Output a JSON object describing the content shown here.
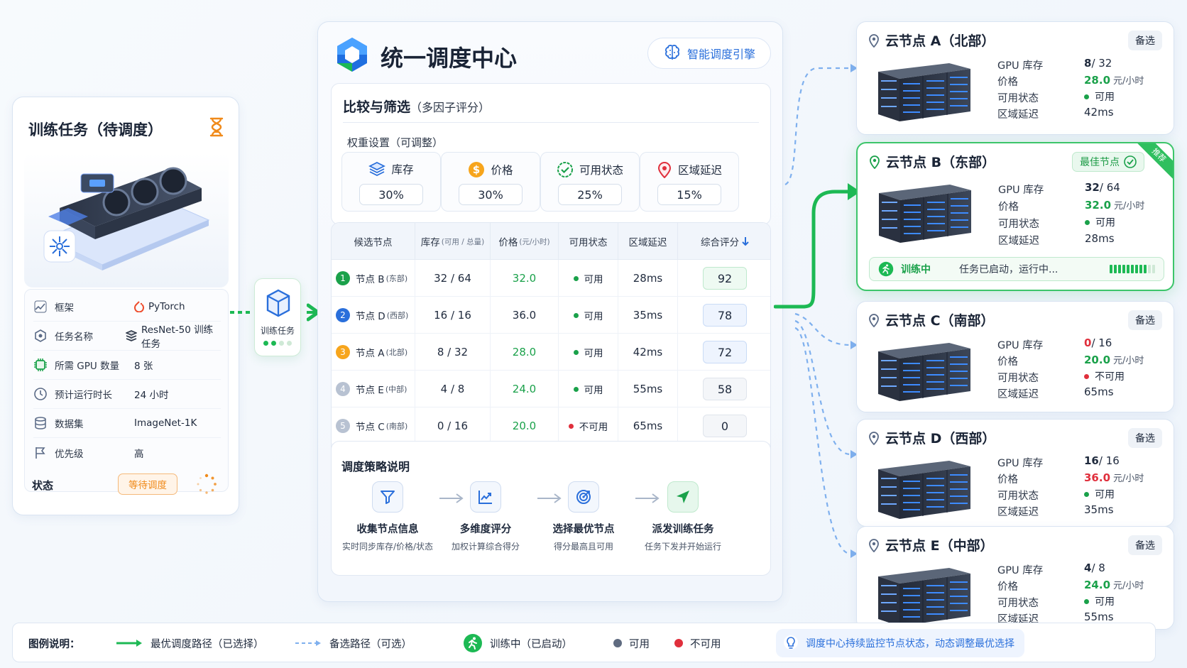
{
  "task": {
    "title": "训练任务（待调度）",
    "props": [
      {
        "icon": "framework-icon",
        "label": "框架",
        "value": "PyTorch",
        "value_icon": "pytorch-icon"
      },
      {
        "icon": "task-name-icon",
        "label": "任务名称",
        "value": "ResNet-50 训练任务",
        "value_icon": "layers-icon"
      },
      {
        "icon": "gpu-chip-icon",
        "label": "所需 GPU 数量",
        "value": "8 张"
      },
      {
        "icon": "clock-icon",
        "label": "预计运行时长",
        "value": "24 小时"
      },
      {
        "icon": "database-icon",
        "label": "数据集",
        "value": "ImageNet-1K"
      },
      {
        "icon": "flag-icon",
        "label": "优先级",
        "value": "高"
      }
    ],
    "status_label": "状态",
    "status_value": "等待调度"
  },
  "connector": {
    "label": "训练任务"
  },
  "center": {
    "title": "统一调度中心",
    "engine": "智能调度引擎",
    "compare_title": "比较与筛选",
    "compare_sub": "（多因子评分）",
    "weights_title": "权重设置（可调整）",
    "weights": [
      {
        "icon": "stack-icon",
        "label": "库存",
        "value": "30%"
      },
      {
        "icon": "dollar-icon",
        "label": "价格",
        "value": "30%"
      },
      {
        "icon": "check-badge-icon",
        "label": "可用状态",
        "value": "25%"
      },
      {
        "icon": "location-icon",
        "label": "区域延迟",
        "value": "15%"
      }
    ],
    "table": {
      "headers": [
        {
          "main": "候选节点",
          "sub": ""
        },
        {
          "main": "库存",
          "sub": "(可用 / 总量)"
        },
        {
          "main": "价格",
          "sub": "(元/小时)"
        },
        {
          "main": "可用状态",
          "sub": ""
        },
        {
          "main": "区域延迟",
          "sub": ""
        },
        {
          "main": "综合评分",
          "sub": ""
        }
      ],
      "rows": [
        {
          "rank": "1",
          "node": "节点 B",
          "region": "(东部)",
          "stock": "32 / 64",
          "price": "32.0",
          "status": "可用",
          "latency": "28ms",
          "score": "92"
        },
        {
          "rank": "2",
          "node": "节点 D",
          "region": "(西部)",
          "stock": "16 / 16",
          "price": "36.0",
          "status": "可用",
          "latency": "35ms",
          "score": "78"
        },
        {
          "rank": "3",
          "node": "节点 A",
          "region": "(北部)",
          "stock": "8 / 32",
          "price": "28.0",
          "status": "可用",
          "latency": "42ms",
          "score": "72"
        },
        {
          "rank": "4",
          "node": "节点 E",
          "region": "(中部)",
          "stock": "4 / 8",
          "price": "24.0",
          "status": "可用",
          "latency": "55ms",
          "score": "58"
        },
        {
          "rank": "5",
          "node": "节点 C",
          "region": "(南部)",
          "stock": "0 / 16",
          "price": "20.0",
          "status": "不可用",
          "latency": "65ms",
          "score": "0"
        }
      ]
    },
    "strategy_title": "调度策略说明",
    "steps": [
      {
        "icon": "funnel-icon",
        "title": "收集节点信息",
        "desc": "实时同步库存/价格/状态"
      },
      {
        "icon": "trend-chart-icon",
        "title": "多维度评分",
        "desc": "加权计算综合得分"
      },
      {
        "icon": "target-icon",
        "title": "选择最优节点",
        "desc": "得分最高且可用"
      },
      {
        "icon": "send-icon",
        "title": "派发训练任务",
        "desc": "任务下发并开始运行"
      }
    ]
  },
  "nodes": [
    {
      "title": "云节点 A（北部）",
      "badge": "备选",
      "gpu_label": "GPU 库存",
      "gpu_a": "8",
      "gpu_b": " / 32",
      "price_label": "价格",
      "price": "28.0",
      "unit": "元/小时",
      "status_label": "可用状态",
      "status": "可用",
      "lat_label": "区域延迟",
      "latency": "42ms"
    },
    {
      "title": "云节点 B（东部）",
      "badge": "最佳节点",
      "ribbon": "推荐",
      "gpu_label": "GPU 库存",
      "gpu_a": "32",
      "gpu_b": " / 64",
      "price_label": "价格",
      "price": "32.0",
      "unit": "元/小时",
      "status_label": "可用状态",
      "status": "可用",
      "lat_label": "区域延迟",
      "latency": "28ms",
      "train_label": "训练中",
      "train_text": "任务已启动，运行中..."
    },
    {
      "title": "云节点 C（南部）",
      "badge": "备选",
      "gpu_label": "GPU 库存",
      "gpu_a": "0",
      "gpu_b": " / 16",
      "price_label": "价格",
      "price": "20.0",
      "unit": "元/小时",
      "status_label": "可用状态",
      "status": "不可用",
      "lat_label": "区域延迟",
      "latency": "65ms"
    },
    {
      "title": "云节点 D（西部）",
      "badge": "备选",
      "gpu_label": "GPU 库存",
      "gpu_a": "16",
      "gpu_b": " / 16",
      "price_label": "价格",
      "price": "36.0",
      "unit": "元/小时",
      "status_label": "可用状态",
      "status": "可用",
      "lat_label": "区域延迟",
      "latency": "35ms"
    },
    {
      "title": "云节点 E（中部）",
      "badge": "备选",
      "gpu_label": "GPU 库存",
      "gpu_a": "4",
      "gpu_b": " / 8",
      "price_label": "价格",
      "price": "24.0",
      "unit": "元/小时",
      "status_label": "可用状态",
      "status": "可用",
      "lat_label": "区域延迟",
      "latency": "55ms"
    }
  ],
  "legend": {
    "title": "图例说明：",
    "best_path": "最优调度路径（已选择）",
    "alt_path": "备选路径（可选）",
    "training": "训练中（已启动）",
    "available": "可用",
    "unavailable": "不可用",
    "tip": "调度中心持续监控节点状态，动态调整最优选择"
  },
  "colors": {
    "accent": "#2a6fdb",
    "green": "#1db954",
    "red": "#e02f3c",
    "orange": "#f08a1a"
  }
}
